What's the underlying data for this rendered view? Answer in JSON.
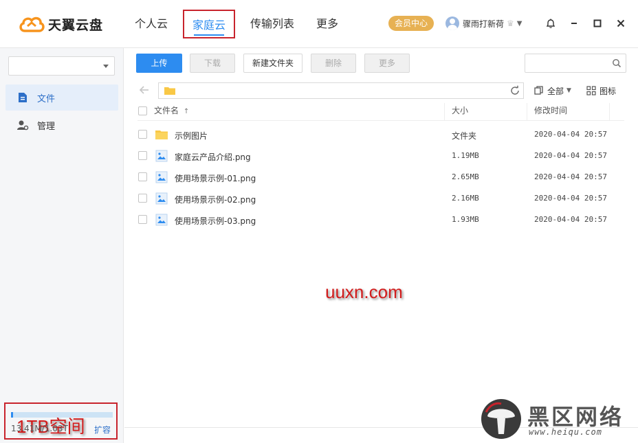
{
  "header": {
    "brand": "天翼云盘",
    "nav": [
      {
        "label": "个人云"
      },
      {
        "label": "家庭云"
      },
      {
        "label": "传输列表"
      },
      {
        "label": "更多"
      }
    ],
    "vip_label": "会员中心",
    "username": "骤雨打新荷"
  },
  "sidebar": {
    "select_value": "",
    "items": [
      {
        "label": "文件",
        "icon": "file-icon"
      },
      {
        "label": "管理",
        "icon": "manage-icon"
      }
    ],
    "storage": {
      "used_fraction": 0.013,
      "text": "13.41M/1.03T",
      "expand_label": "扩容"
    }
  },
  "annotations": {
    "space_label": "1TB空间",
    "site_watermark": "uuxn.com"
  },
  "toolbar": {
    "upload": "上传",
    "download": "下载",
    "new_folder": "新建文件夹",
    "delete": "删除",
    "more": "更多",
    "search_placeholder": ""
  },
  "view": {
    "filter_label": "全部",
    "icon_view_label": "图标"
  },
  "table": {
    "columns": {
      "name": "文件名",
      "size": "大小",
      "modified": "修改时间"
    },
    "rows": [
      {
        "name": "示例图片",
        "size": "文件夹",
        "modified": "2020-04-04 20:57",
        "type": "folder"
      },
      {
        "name": "家庭云产品介绍.png",
        "size": "1.19MB",
        "modified": "2020-04-04 20:57",
        "type": "image"
      },
      {
        "name": "使用场景示例-01.png",
        "size": "2.65MB",
        "modified": "2020-04-04 20:57",
        "type": "image"
      },
      {
        "name": "使用场景示例-02.png",
        "size": "2.16MB",
        "modified": "2020-04-04 20:57",
        "type": "image"
      },
      {
        "name": "使用场景示例-03.png",
        "size": "1.93MB",
        "modified": "2020-04-04 20:57",
        "type": "image"
      }
    ]
  },
  "branding_watermark": {
    "text": "黑区网络",
    "url": "www.heiqu.com"
  },
  "colors": {
    "accent": "#2d8cf0",
    "vip": "#e7b153",
    "annotation_red": "#d21c1c",
    "folder": "#f9c846"
  }
}
